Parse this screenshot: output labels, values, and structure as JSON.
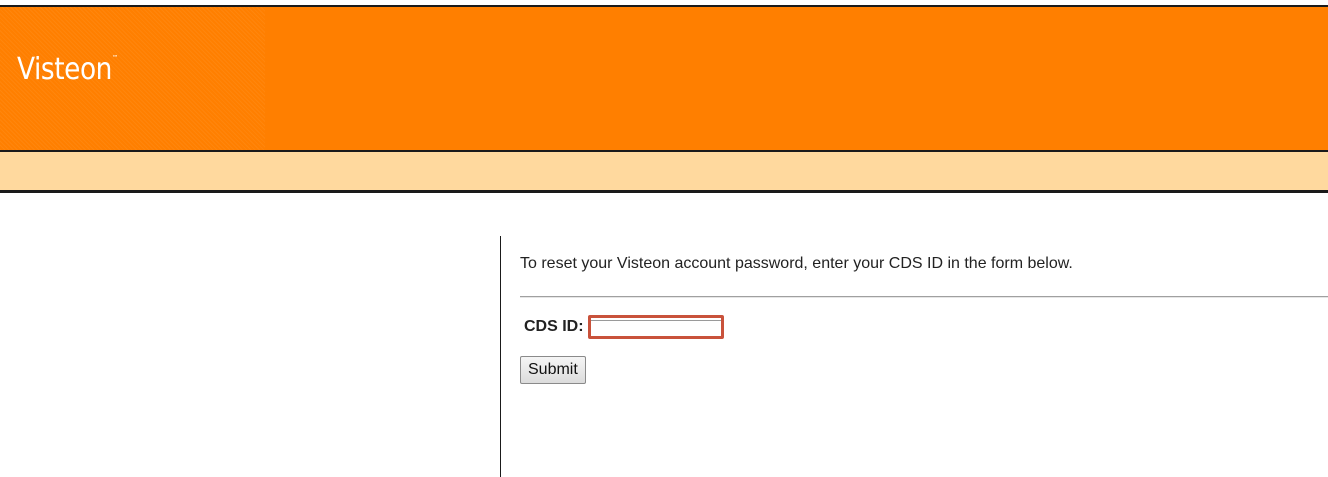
{
  "header": {
    "logo_text": "Visteon",
    "logo_mark": "™"
  },
  "main": {
    "intro": "To reset your Visteon account password, enter your CDS ID in the form below.",
    "form": {
      "cds_label": "CDS ID:",
      "cds_value": "",
      "submit_label": "Submit"
    }
  },
  "colors": {
    "brand_orange": "#ff7f00",
    "subheader": "#ffd99e",
    "highlight_border": "#c9523b"
  }
}
